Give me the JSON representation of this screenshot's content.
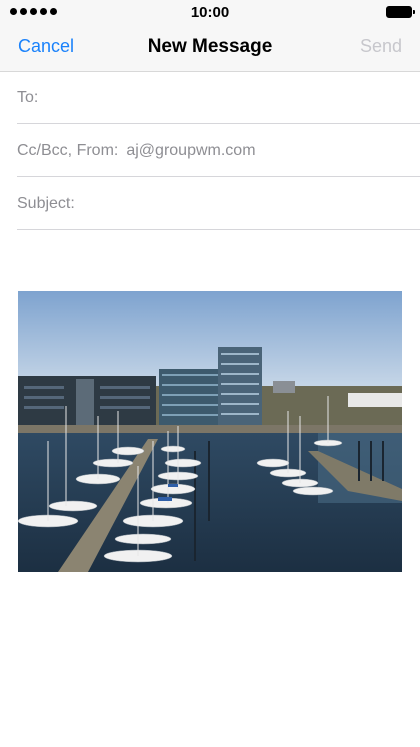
{
  "status_bar": {
    "time": "10:00"
  },
  "nav": {
    "cancel_label": "Cancel",
    "title": "New Message",
    "send_label": "Send"
  },
  "fields": {
    "to_label": "To:",
    "cc_from_label": "Cc/Bcc, From:",
    "from_value": "aj@groupwm.com",
    "subject_label": "Subject:"
  },
  "colors": {
    "accent": "#1a82fb",
    "disabled": "#c7c7cc",
    "label": "#8e8e93"
  },
  "attachment": {
    "type": "photo",
    "subject": "harbor-marina"
  }
}
